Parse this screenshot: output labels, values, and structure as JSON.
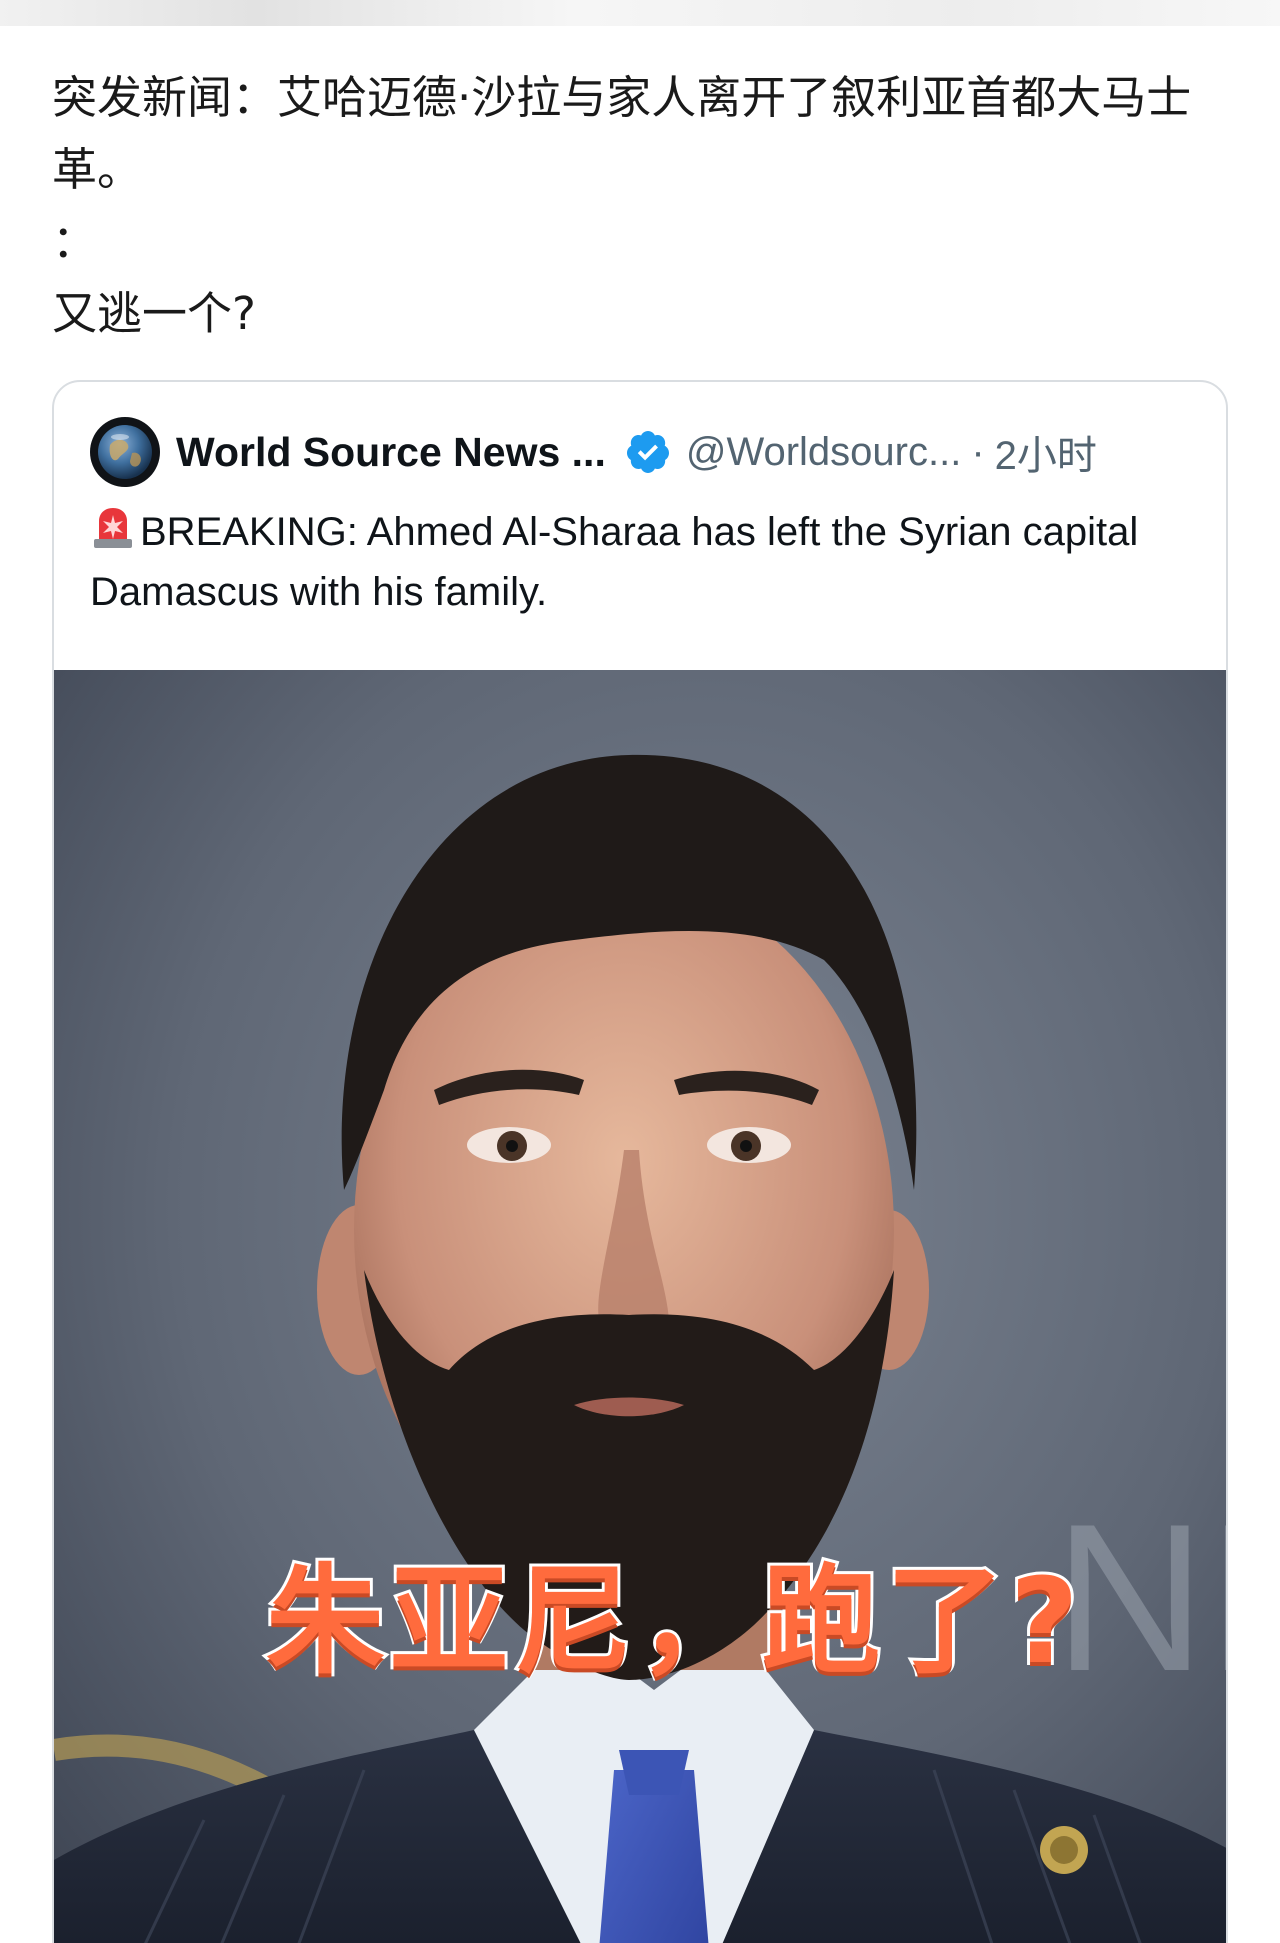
{
  "post": {
    "lines": [
      "突发新闻：艾哈迈德·沙拉与家人离开了叙利亚首都大马士革。",
      "：",
      "又逃一个?"
    ]
  },
  "quoted_tweet": {
    "author_name": "World Source News ...",
    "handle": "@Worldsourc...",
    "separator": "·",
    "time": "2小时",
    "text": "BREAKING: Ahmed Al-Sharaa has left the Syrian capital Damascus with his family.",
    "image_caption": "朱亚尼，跑了?",
    "image_bg_text": "NIT"
  },
  "icons": {
    "avatar": "globe-avatar",
    "verified": "verified-badge-icon",
    "siren": "siren-emoji-icon"
  },
  "colors": {
    "verified_blue": "#1d9bf0",
    "caption_orange": "#ff6b3d",
    "photo_background": "#5f6775"
  }
}
